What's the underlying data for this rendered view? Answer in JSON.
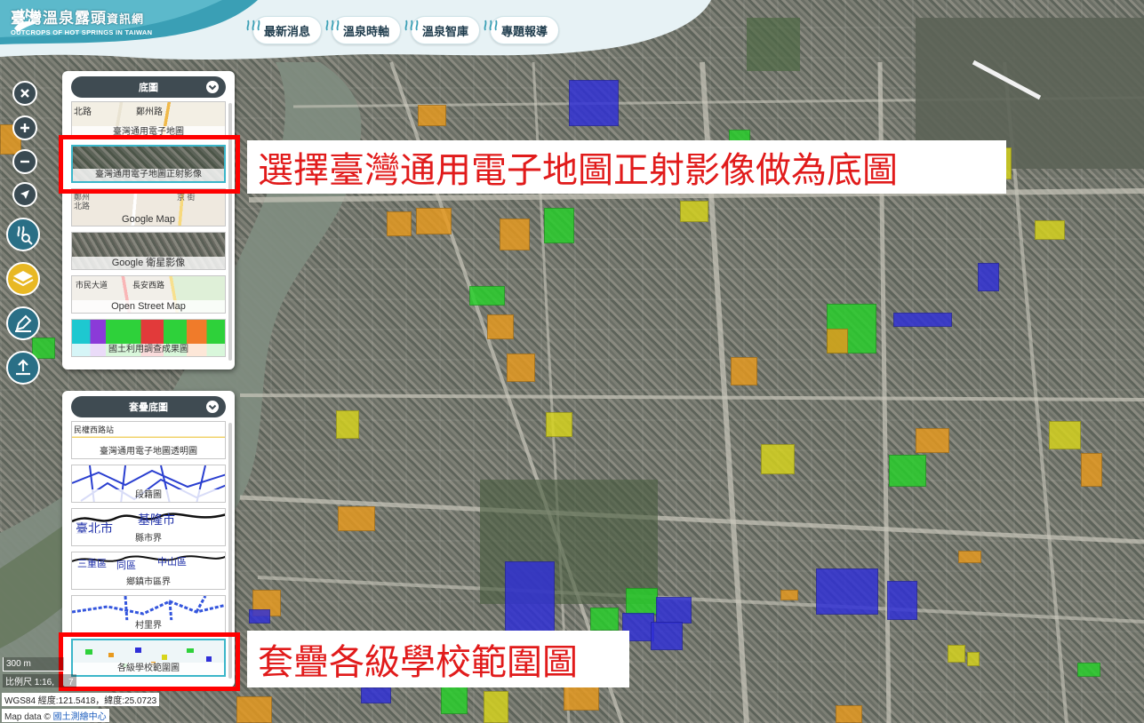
{
  "header": {
    "logo_title_main": "臺灣溫泉露頭",
    "logo_title_small": "資訊網",
    "logo_subtitle": "OUTCROPS OF HOT SPRINGS IN TAIWAN",
    "nav": [
      "最新消息",
      "溫泉時軸",
      "溫泉智庫",
      "專題報導"
    ]
  },
  "toolbar": {
    "icons": [
      "close-icon",
      "zoom-in-icon",
      "zoom-out-icon",
      "locate-icon",
      "hot-spring-search-icon",
      "layers-icon",
      "draw-pen-icon",
      "upload-icon"
    ]
  },
  "base_panel": {
    "title": "底圖",
    "items": [
      {
        "label": "臺灣通用電子地圖"
      },
      {
        "label": "臺灣通用電子地圖正射影像"
      },
      {
        "label": "Google Map"
      },
      {
        "label": "Google 衛星影像"
      },
      {
        "label": "Open Street Map"
      },
      {
        "label": "國土利用調查成果圖"
      }
    ],
    "selected_index": 1
  },
  "overlay_panel": {
    "title": "套疊底圖",
    "items": [
      {
        "label": "臺灣通用電子地圖透明圖"
      },
      {
        "label": "段籍圖"
      },
      {
        "label": "縣市界"
      },
      {
        "label": "鄉鎮市區界"
      },
      {
        "label": "村里界"
      },
      {
        "label": "各級學校範圍圖"
      }
    ],
    "selected_index": 5
  },
  "annotations": {
    "base_callout": "選擇臺灣通用電子地圖正射影像做為底圖",
    "overlay_callout": "套疊各級學校範圍圖",
    "highlight_color": "#ff0000"
  },
  "map": {
    "scale_bar": "300 m",
    "scale": "比例尺 1:16,",
    "scale_suffix": "7",
    "coordinates": "WGS84 經度:121.5418，緯度:25.0723",
    "attribution_prefix": "Map data © ",
    "attribution_link": "國土測繪中心",
    "zone_colors": {
      "orange": "#e89a1e",
      "blue": "#2f2fd8",
      "green": "#27d12a",
      "yellow": "#d8d51c"
    }
  },
  "thumb_text": {
    "street_a": "北路",
    "street_b": "鄭州路",
    "gmap_a": "鄭州",
    "gmap_b": "北路",
    "gmap_c": "京 街",
    "osm_a": "市民大道",
    "osm_b": "長安西路",
    "trans_a": "民權西路站",
    "county_a": "臺北市",
    "county_b": "基隆市",
    "town_a": "三重區",
    "town_b": "中山區",
    "town_c": "同區"
  }
}
